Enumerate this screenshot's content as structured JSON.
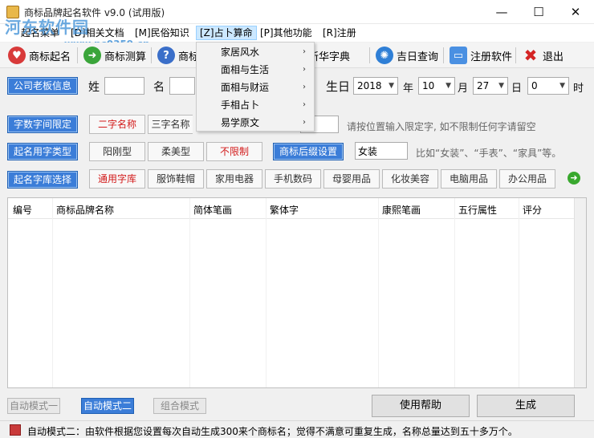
{
  "window": {
    "title": "商标品牌起名软件 v9.0 (试用版)",
    "watermark": "河东软件园",
    "watermark_url": "www.pc0359.cn"
  },
  "menu": {
    "items": [
      {
        "label": "起名菜单"
      },
      {
        "label": "[D]相关文档"
      },
      {
        "label": "[M]民俗知识"
      },
      {
        "label": "[Z]占卜算命"
      },
      {
        "label": "[P]其他功能"
      },
      {
        "label": "[R]注册"
      }
    ],
    "dropdown": [
      {
        "label": "家居风水"
      },
      {
        "label": "面相与生活"
      },
      {
        "label": "面相与财运"
      },
      {
        "label": "手相占卜"
      },
      {
        "label": "易学原文"
      }
    ]
  },
  "toolbar": {
    "naming": "商标起名",
    "evaluate": "商标测算",
    "help_partial": "商标",
    "dictionary": "新华字典",
    "lucky_day": "吉日查询",
    "register": "注册软件",
    "exit": "退出"
  },
  "owner": {
    "section": "公司老板信息",
    "surname_label": "姓",
    "name_label": "名",
    "surname_value": "",
    "name_value": "",
    "birthday_label": "生日",
    "year": "2018",
    "year_label": "年",
    "month": "10",
    "month_label": "月",
    "day": "27",
    "day_label": "日",
    "hour": "0",
    "hour_label": "时"
  },
  "length": {
    "section": "字数字间限定",
    "two_char": "二字名称",
    "three_char_partial": "三字名称",
    "hint": "请按位置输入限定字, 如不限制任何字请留空"
  },
  "style": {
    "section": "起名用字类型",
    "strong": "阳刚型",
    "soft": "柔美型",
    "unlimited": "不限制",
    "suffix_btn": "商标后缀设置",
    "suffix_value": "女装",
    "suffix_hint": "比如“女装”、“手表”、“家具”等。"
  },
  "library": {
    "section": "起名字库选择",
    "items": [
      "通用字库",
      "服饰鞋帽",
      "家用电器",
      "手机数码",
      "母婴用品",
      "化妆美容",
      "电脑用品",
      "办公用品"
    ]
  },
  "grid": {
    "columns": [
      "编号",
      "商标品牌名称",
      "简体笔画",
      "繁体字",
      "康熙笔画",
      "五行属性",
      "评分"
    ]
  },
  "bottom": {
    "mode1": "自动模式一",
    "mode2": "自动模式二",
    "combo": "组合模式",
    "help": "使用帮助",
    "generate": "生成"
  },
  "status": {
    "text": "自动模式二：由软件根据您设置每次自动生成300来个商标名；觉得不满意可重复生成，名称总量达到五十多万个。"
  },
  "colors": {
    "accent": "#3b7dd8",
    "unlimited_red": "#d21a1a",
    "menu_highlight": "#cce8ff"
  }
}
